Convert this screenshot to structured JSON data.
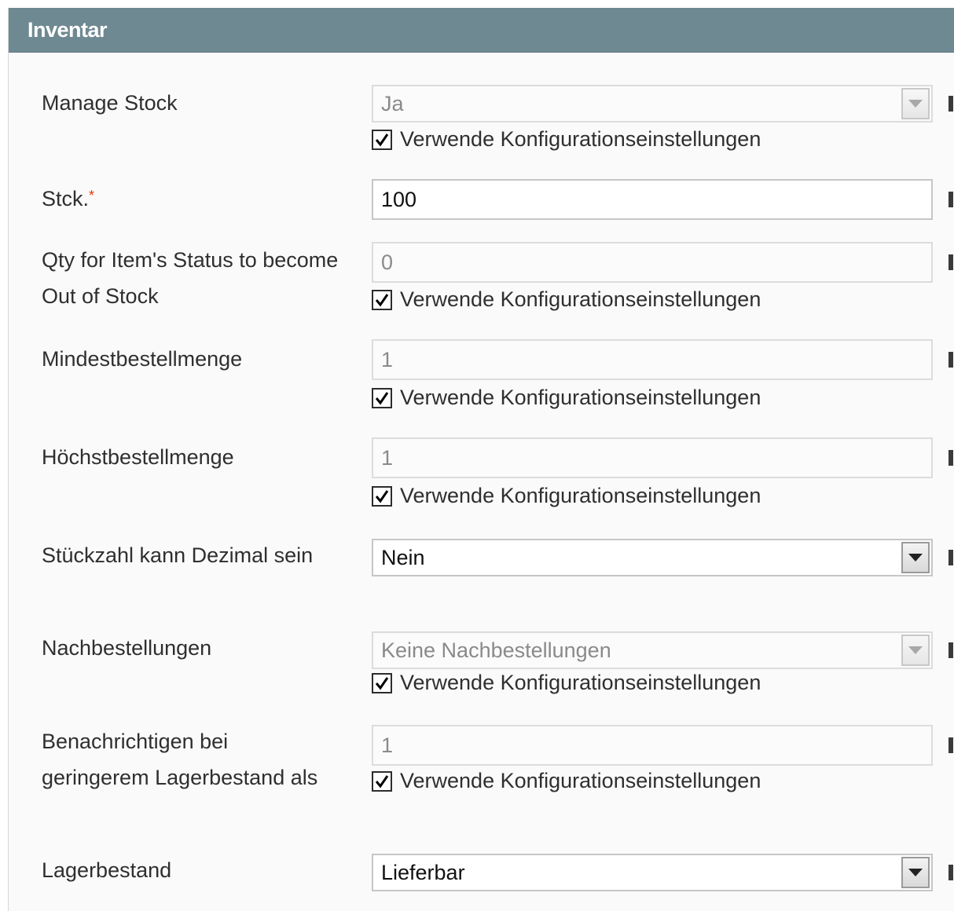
{
  "panel": {
    "title": "Inventar"
  },
  "use_config_label": "Verwende Konfigurationseinstellungen",
  "fields": {
    "manage_stock": {
      "label": "Manage Stock",
      "value": "Ja"
    },
    "qty": {
      "label": "Stck.",
      "required_mark": "*",
      "value": "100"
    },
    "min_qty": {
      "label": "Qty for Item's Status to become Out of Stock",
      "value": "0"
    },
    "min_sale_qty": {
      "label": "Mindestbestellmenge",
      "value": "1"
    },
    "max_sale_qty": {
      "label": "Höchstbestellmenge",
      "value": "1"
    },
    "is_qty_decimal": {
      "label": "Stückzahl kann Dezimal sein",
      "value": "Nein"
    },
    "backorders": {
      "label": "Nachbestellungen",
      "value": "Keine Nachbestellungen"
    },
    "notify_stock_qty": {
      "label": "Benachrichtigen bei geringerem Lagerbestand als",
      "value": "1"
    },
    "stock_status": {
      "label": "Lagerbestand",
      "value": "Lieferbar"
    }
  }
}
